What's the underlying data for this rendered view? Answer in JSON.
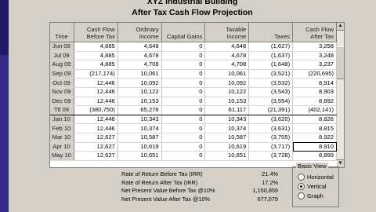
{
  "window": {
    "title": "XYZ Industrial Building",
    "subtitle": "After Tax Cash Flow Projection"
  },
  "table": {
    "headers": [
      "Time",
      "Cash Flow Before Tax",
      "Ordinary Income",
      "Capital Gains",
      "Taxable Income",
      "Taxes",
      "Cash Flow After Tax"
    ],
    "rows": [
      [
        "Jun 09",
        "4,885",
        "4,648",
        "0",
        "4,648",
        "(1,627)",
        "3,258"
      ],
      [
        "Jul 09",
        "4,885",
        "4,678",
        "0",
        "4,678",
        "(1,637)",
        "3,248"
      ],
      [
        "Aug 09",
        "4,885",
        "4,708",
        "0",
        "4,708",
        "(1,648)",
        "3,237"
      ],
      [
        "Sep 09",
        "(217,174)",
        "10,061",
        "0",
        "10,061",
        "(3,521)",
        "(220,695)"
      ],
      [
        "Oct 09",
        "12,446",
        "10,092",
        "0",
        "10,092",
        "(3,532)",
        "8,914"
      ],
      [
        "Nov 09",
        "12,446",
        "10,122",
        "0",
        "10,122",
        "(3,543)",
        "8,903"
      ],
      [
        "Dec 09",
        "12,446",
        "10,153",
        "0",
        "10,153",
        "(3,554)",
        "8,892"
      ],
      [
        "Ttl 09",
        "(380,750)",
        "65,276",
        "0",
        "61,117",
        "(21,391)",
        "(402,141)"
      ],
      [
        "Jan 10",
        "12,446",
        "10,343",
        "0",
        "10,343",
        "(3,620)",
        "8,826"
      ],
      [
        "Feb 10",
        "12,446",
        "10,374",
        "0",
        "10,374",
        "(3,631)",
        "8,815"
      ],
      [
        "Mar 10",
        "12,627",
        "10,587",
        "0",
        "10,587",
        "(3,705)",
        "8,922"
      ],
      [
        "Apr 10",
        "12,627",
        "10,619",
        "0",
        "10,619",
        "(3,717)",
        "8,910"
      ],
      [
        "May 10",
        "12,627",
        "10,651",
        "0",
        "10,651",
        "(3,728)",
        "8,899"
      ]
    ],
    "total_row_index": 7,
    "selected_cell": {
      "row": 11,
      "col": 6
    }
  },
  "summary": [
    {
      "label": "Rate of Return Before Tax (IRR)",
      "value": "21.4%"
    },
    {
      "label": "Rate of Return After Tax (IRR)",
      "value": "17.2%"
    },
    {
      "label": "Net Present Value Before Tax @10%",
      "value": "1,150,859"
    },
    {
      "label": "Net Present Value After Tax @10%",
      "value": "677,079"
    }
  ],
  "basic_view": {
    "legend": "Basic View",
    "options": [
      {
        "label": "Horizontal",
        "selected": false
      },
      {
        "label": "Vertical",
        "selected": true
      },
      {
        "label": "Graph",
        "selected": false
      }
    ]
  },
  "colors": {
    "sidebar": "#2f2b86",
    "panel": "#d4d0c8"
  }
}
